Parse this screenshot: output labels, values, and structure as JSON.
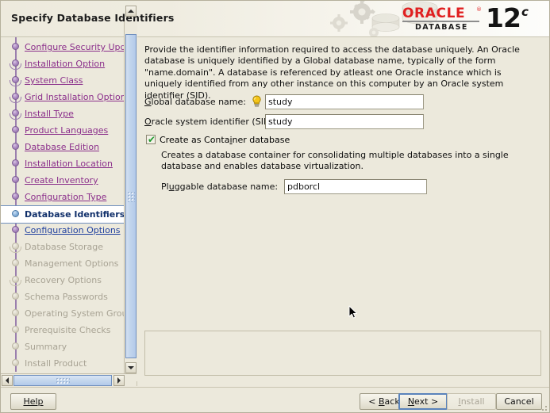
{
  "window": {
    "title": "Specify Database Identifiers"
  },
  "branding": {
    "oracle": "ORACLE",
    "registered": "®",
    "database": "DATABASE",
    "version": "12",
    "version_suffix": "c",
    "red": "#e02020"
  },
  "sidebar": {
    "steps": [
      {
        "label": "Configure Security Updates",
        "state": "done",
        "node": "bulb"
      },
      {
        "label": "Installation Option",
        "state": "done",
        "node": "branch"
      },
      {
        "label": "System Class",
        "state": "done",
        "node": "branch"
      },
      {
        "label": "Grid Installation Options",
        "state": "done",
        "node": "branch"
      },
      {
        "label": "Install Type",
        "state": "done",
        "node": "branch"
      },
      {
        "label": "Product Languages",
        "state": "done",
        "node": "bulb"
      },
      {
        "label": "Database Edition",
        "state": "done",
        "node": "bulb"
      },
      {
        "label": "Installation Location",
        "state": "done",
        "node": "bulb"
      },
      {
        "label": "Create Inventory",
        "state": "done",
        "node": "bulb"
      },
      {
        "label": "Configuration Type",
        "state": "done",
        "node": "bulb"
      },
      {
        "label": "Database Identifiers",
        "state": "active",
        "node": "bulb"
      },
      {
        "label": "Configuration Options",
        "state": "link",
        "node": "bulb"
      },
      {
        "label": "Database Storage",
        "state": "disabled",
        "node": "branch"
      },
      {
        "label": "Management Options",
        "state": "disabled",
        "node": "bulb"
      },
      {
        "label": "Recovery Options",
        "state": "disabled",
        "node": "branch"
      },
      {
        "label": "Schema Passwords",
        "state": "disabled",
        "node": "bulb"
      },
      {
        "label": "Operating System Groups",
        "state": "disabled",
        "node": "bulb"
      },
      {
        "label": "Prerequisite Checks",
        "state": "disabled",
        "node": "bulb"
      },
      {
        "label": "Summary",
        "state": "disabled",
        "node": "bulb"
      },
      {
        "label": "Install Product",
        "state": "disabled",
        "node": "bulb"
      }
    ]
  },
  "main": {
    "intro": "Provide the identifier information required to access the database uniquely. An Oracle database is uniquely identified by a Global database name, typically of the form \"name.domain\". A database is referenced by atleast one Oracle instance which is uniquely identified from any other instance on this computer by an Oracle system identifier (SID).",
    "global_db_name": {
      "label": "Global database name:",
      "value": "study",
      "hint_icon": "lightbulb-icon"
    },
    "sid": {
      "label": "Oracle system identifier (SID):",
      "value": "study"
    },
    "container_checkbox": {
      "label": "Create as Container database",
      "checked": true,
      "tick": "✔"
    },
    "container_description": "Creates a database container for consolidating multiple databases into a single database and enables database virtualization.",
    "pluggable_db_name": {
      "label": "Pluggable database name:",
      "value": "pdborcl"
    }
  },
  "footer": {
    "help": "Help",
    "back": "< Back",
    "next": "Next >",
    "install": "Install",
    "cancel": "Cancel",
    "install_enabled": false,
    "next_focused": true
  }
}
